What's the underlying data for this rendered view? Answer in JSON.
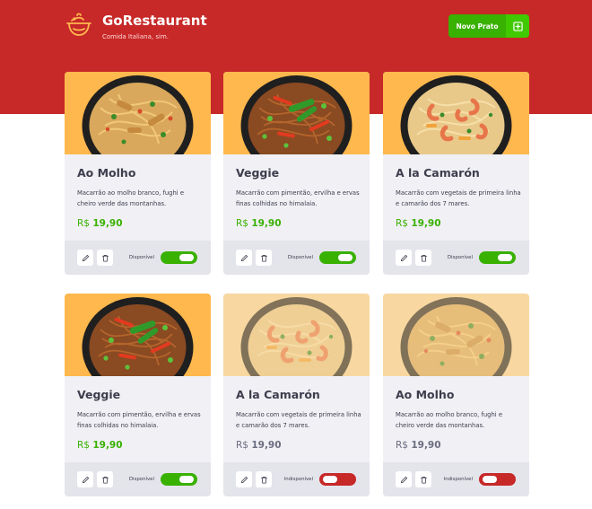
{
  "header": {
    "title": "GoRestaurant",
    "subtitle": "Comida Italiana, sim.",
    "new_button_label": "Novo Prato",
    "new_button_icon": "plus-square-icon",
    "logo_icon": "cooking-pot-icon"
  },
  "colors": {
    "header_bg": "#c72828",
    "accent_green": "#39b100",
    "unavailable_red": "#c72828",
    "card_bg": "#f0f0f5",
    "card_footer_bg": "#e4e4eb",
    "image_bg": "#ffb84d"
  },
  "dishes": [
    {
      "name": "Ao Molho",
      "description": "Macarrão ao molho branco, fughi e cheiro verde das montanhas.",
      "price_currency": "R$",
      "price_value": "19,90",
      "status_label": "Disponível",
      "available": true,
      "image": "pasta-ao-molho"
    },
    {
      "name": "Veggie",
      "description": "Macarrão com pimentão, ervilha e ervas finas colhidas no himalaia.",
      "price_currency": "R$",
      "price_value": "19,90",
      "status_label": "Disponível",
      "available": true,
      "image": "pasta-veggie"
    },
    {
      "name": "A la Camarón",
      "description": "Macarrão com vegetais de primeira linha e camarão dos 7 mares.",
      "price_currency": "R$",
      "price_value": "19,90",
      "status_label": "Disponível",
      "available": true,
      "image": "pasta-camaron"
    },
    {
      "name": "Veggie",
      "description": "Macarrão com pimentão, ervilha e ervas finas colhidas no himalaia.",
      "price_currency": "R$",
      "price_value": "19,90",
      "status_label": "Disponível",
      "available": true,
      "image": "pasta-veggie"
    },
    {
      "name": "A la Camarón",
      "description": "Macarrão com vegetais de primeira linha e camarão dos 7 mares.",
      "price_currency": "R$",
      "price_value": "19,90",
      "status_label": "Indisponível",
      "available": false,
      "image": "pasta-camaron"
    },
    {
      "name": "Ao Molho",
      "description": "Macarrão ao molho branco, fughi e cheiro verde das montanhas.",
      "price_currency": "R$",
      "price_value": "19,90",
      "status_label": "Indisponível",
      "available": false,
      "image": "pasta-ao-molho"
    }
  ],
  "card_actions": {
    "edit_icon": "pencil-icon",
    "delete_icon": "trash-icon"
  }
}
